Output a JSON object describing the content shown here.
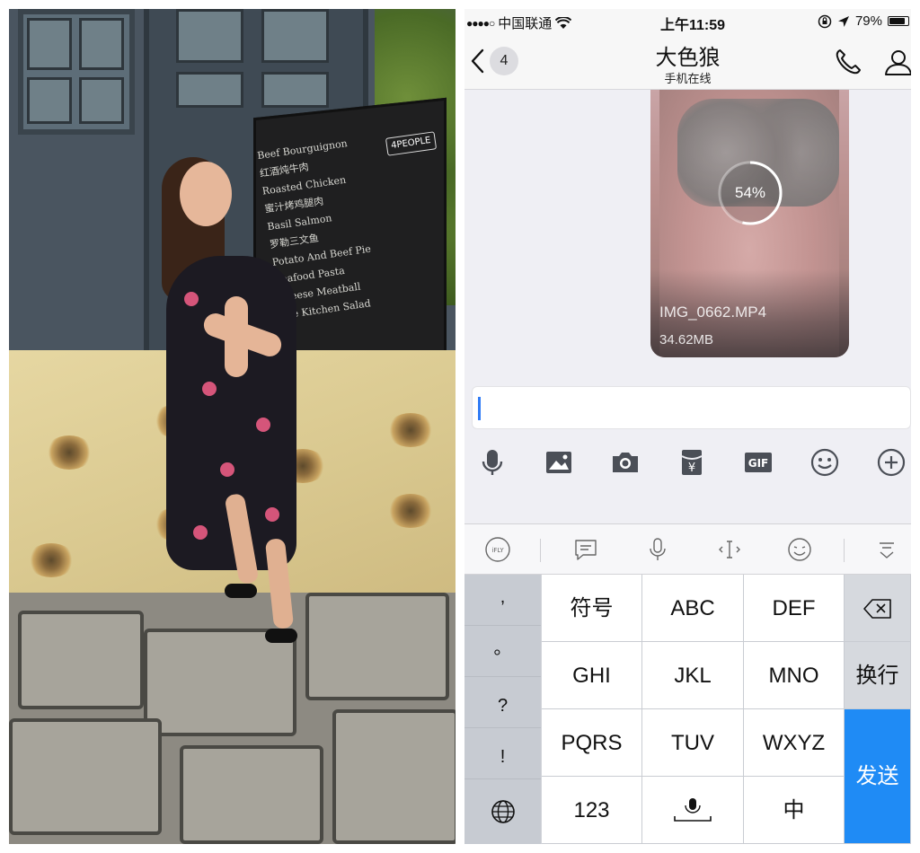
{
  "status_bar": {
    "signal_dots": "●●●●○",
    "carrier": "中国联通",
    "time": "上午11:59",
    "battery_pct": "79%",
    "battery_level": 0.79
  },
  "nav": {
    "unread_count": "4",
    "contact_name": "大色狼",
    "contact_status": "手机在线"
  },
  "message": {
    "progress_label": "54%",
    "progress_fraction": 0.54,
    "file_name": "IMG_0662.MP4",
    "file_size": "34.62MB"
  },
  "toolbar": {
    "icons": [
      "mic-icon",
      "image-icon",
      "camera-icon",
      "red-packet-icon",
      "gif-icon",
      "emoji-icon",
      "plus-icon"
    ],
    "gif_label": "GIF",
    "yen_label": "¥"
  },
  "keyboard_top": {
    "ifly_label": "iFLY"
  },
  "keyboard": {
    "symbols": [
      ",",
      "。",
      "?",
      "!"
    ],
    "row1": [
      "符号",
      "ABC",
      "DEF"
    ],
    "row2": [
      "GHI",
      "JKL",
      "MNO"
    ],
    "row3": [
      "PQRS",
      "TUV",
      "WXYZ"
    ],
    "row4_num": "123",
    "newline": "换行",
    "send": "发送",
    "backspace_icon": "backspace-icon",
    "globe_icon": "globe-icon",
    "mic_icon": "mic-icon",
    "lang_partial": "中"
  },
  "photo": {
    "sign_logo": "4PEOPLE",
    "sign_lines": [
      "Beef Bourguignon",
      "红酒炖牛肉",
      "Roasted Chicken",
      "蜜汁烤鸡腿肉",
      "Basil Salmon",
      "罗勒三文鱼",
      "Potato And Beef Pie",
      "Seafood Pasta",
      "Cheese Meatball",
      "The Kitchen Salad"
    ]
  },
  "colors": {
    "accent_blue": "#1f8bf5",
    "caret_blue": "#2f7bf5"
  }
}
